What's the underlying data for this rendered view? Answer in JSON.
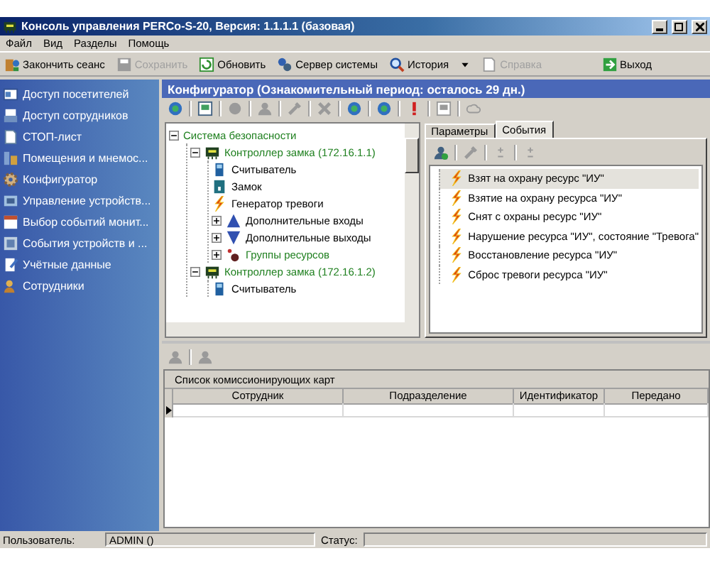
{
  "window": {
    "title": "Консоль управления PERCo-S-20, Версия: 1.1.1.1 (базовая)"
  },
  "menu": [
    "Файл",
    "Вид",
    "Разделы",
    "Помощь"
  ],
  "toolbar": [
    {
      "label": "Закончить сеанс",
      "kind": "door",
      "disabled": false
    },
    {
      "label": "Сохранить",
      "kind": "disk",
      "disabled": true
    },
    {
      "label": "Обновить",
      "kind": "refresh",
      "disabled": false
    },
    {
      "label": "Сервер системы",
      "kind": "server",
      "disabled": false
    },
    {
      "label": "История",
      "kind": "magnifier",
      "disabled": false
    },
    {
      "kind": "dropdown",
      "disabled": false
    },
    {
      "label": "Справка",
      "kind": "page",
      "disabled": true
    },
    {
      "label": "Выход",
      "kind": "exit",
      "disabled": false
    }
  ],
  "sidebar": {
    "items": [
      {
        "label": "Доступ посетителей",
        "kind": "card"
      },
      {
        "label": "Доступ сотрудников",
        "kind": "printer"
      },
      {
        "label": "СТОП-лист",
        "kind": "page"
      },
      {
        "label": "Помещения и мнемос...",
        "kind": "rooms"
      },
      {
        "label": "Конфигуратор",
        "kind": "gear"
      },
      {
        "label": "Управление устройств...",
        "kind": "devices"
      },
      {
        "label": "Выбор событий монит...",
        "kind": "calendar"
      },
      {
        "label": "События устройств и ...",
        "kind": "events"
      },
      {
        "label": "Учётные данные",
        "kind": "notes"
      },
      {
        "label": "Сотрудники",
        "kind": "people"
      }
    ]
  },
  "panel": {
    "title": "Конфигуратор (Ознакомительный период: осталось 29 дн.)",
    "icon_toolbar": [
      {
        "kind": "globe",
        "disabled": false
      },
      {
        "kind": "network",
        "disabled": false
      },
      {
        "kind": "blob",
        "disabled": true
      },
      {
        "kind": "person",
        "disabled": true
      },
      {
        "kind": "wrench",
        "disabled": true
      },
      {
        "kind": "cross",
        "disabled": true
      },
      {
        "kind": "globe",
        "disabled": false
      },
      {
        "kind": "globe",
        "disabled": false
      },
      {
        "kind": "alert",
        "disabled": false
      },
      {
        "kind": "network",
        "disabled": true
      },
      {
        "kind": "cloud",
        "disabled": true
      }
    ],
    "tree": [
      {
        "label": "Система безопасности",
        "kind": "system",
        "expanded": true,
        "children": [
          {
            "label": "Контроллер замка (172.16.1.1)",
            "kind": "controller",
            "expanded": true,
            "children": [
              {
                "label": "Считыватель",
                "kind": "reader"
              },
              {
                "label": "Замок",
                "kind": "lock"
              },
              {
                "label": "Генератор тревоги",
                "kind": "alarm"
              },
              {
                "label": "Дополнительные входы",
                "kind": "inputs",
                "expanded": false
              },
              {
                "label": "Дополнительные выходы",
                "kind": "outputs",
                "expanded": false
              },
              {
                "label": "Группы ресурсов",
                "kind": "group",
                "expanded": false
              }
            ]
          },
          {
            "label": "Контроллер замка (172.16.1.2)",
            "kind": "controller",
            "expanded": true,
            "children": [
              {
                "label": "Считыватель",
                "kind": "reader"
              }
            ]
          }
        ]
      }
    ],
    "tabs": [
      {
        "label": "Параметры",
        "selected": false
      },
      {
        "label": "События",
        "selected": true
      }
    ],
    "events_toolbar": [
      {
        "kind": "personadd",
        "disabled": false
      },
      {
        "kind": "wrench",
        "disabled": true
      },
      {
        "kind": "plusminus",
        "disabled": true
      },
      {
        "kind": "plusminus",
        "disabled": true
      }
    ],
    "events": [
      {
        "label": "Взят на охрану ресурс \"ИУ\"",
        "selected": true
      },
      {
        "label": "Взятие на охрану ресурса \"ИУ\"",
        "selected": false
      },
      {
        "label": "Снят с охраны ресурс \"ИУ\"",
        "selected": false
      },
      {
        "label": "Нарушение ресурса \"ИУ\", состояние \"Тревога\"",
        "selected": false
      },
      {
        "label": "Восстановление ресурса \"ИУ\"",
        "selected": false
      },
      {
        "label": "Сброс тревоги ресурса \"ИУ\"",
        "selected": false
      }
    ],
    "cards_toolbar": [
      {
        "kind": "person",
        "disabled": true
      },
      {
        "kind": "person",
        "disabled": true
      }
    ],
    "cards_table": {
      "title": "Список комиссионирующих карт",
      "columns": [
        "Сотрудник",
        "Подразделение",
        "Идентификатор",
        "Передано"
      ],
      "rows": [
        {
          "selected": true
        }
      ]
    }
  },
  "status_bar": {
    "user_label": "Пользователь:",
    "user": "ADMIN ()",
    "status_label": "Статус:"
  }
}
